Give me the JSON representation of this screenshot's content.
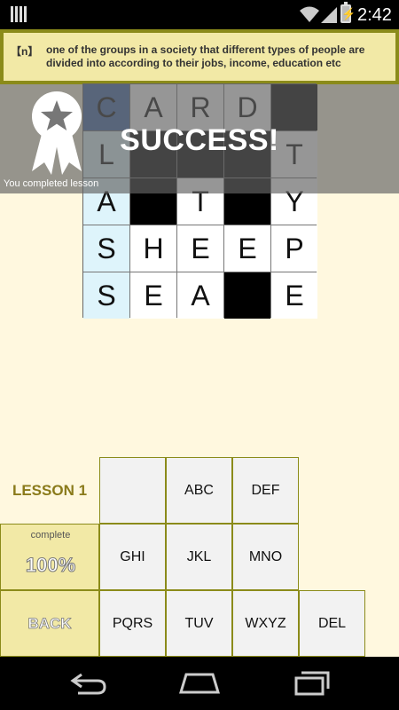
{
  "status_bar": {
    "time": "2:42"
  },
  "definition": {
    "pos": "【n】",
    "text": "one of the groups in a society that different types of people are divided into according to their jobs, income, education etc"
  },
  "grid": {
    "rows": [
      [
        "C",
        "A",
        "R",
        "D",
        "#"
      ],
      [
        "L",
        "#",
        "#",
        "#",
        "T"
      ],
      [
        "A",
        "#",
        "T",
        "#",
        "Y"
      ],
      [
        "S",
        "H",
        "E",
        "E",
        "P"
      ],
      [
        "S",
        "E",
        "A",
        "#",
        "E"
      ]
    ]
  },
  "success": {
    "title": "SUCCESS!",
    "subtitle": "You completed lesson"
  },
  "keypad": {
    "lesson_label": "LESSON 1",
    "complete_label": "complete",
    "complete_value": "100%",
    "back_label": "BACK",
    "keys": [
      "",
      "ABC",
      "DEF",
      "GHI",
      "JKL",
      "MNO",
      "PQRS",
      "TUV",
      "WXYZ",
      "DEL"
    ]
  },
  "icons": {
    "status": [
      "notification-icon",
      "wifi-icon",
      "signal-icon",
      "battery-icon"
    ],
    "overlay": "award-ribbon-icon",
    "nav": [
      "back-nav-icon",
      "home-nav-icon",
      "recents-nav-icon"
    ]
  },
  "colors": {
    "background": "#fff8df",
    "banner": "#f2e9a6",
    "border": "#8b8b1a",
    "selected_cell": "#3e66a8",
    "highlighted_cell": "#def4fb",
    "lesson_text": "#8a7a1a"
  }
}
